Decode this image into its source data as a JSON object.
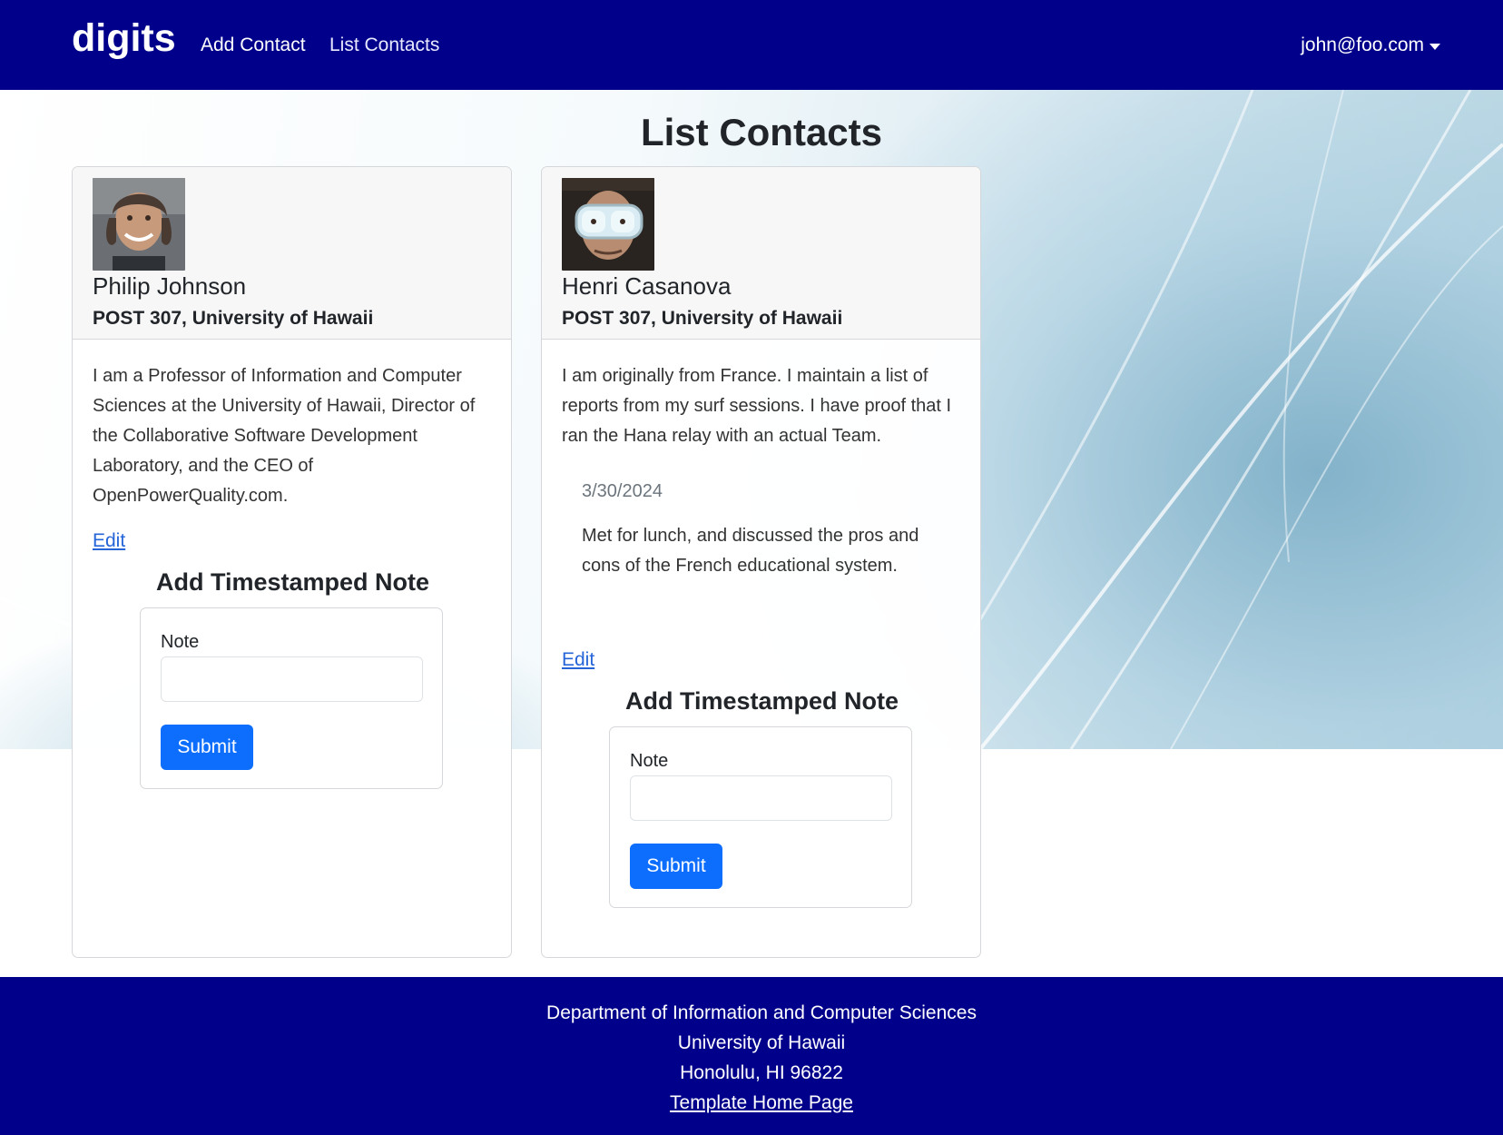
{
  "navbar": {
    "brand": "digits",
    "links": [
      "Add Contact",
      "List Contacts"
    ],
    "user": "john@foo.com"
  },
  "page": {
    "title": "List Contacts"
  },
  "contacts": [
    {
      "name": "Philip Johnson",
      "address": "POST 307, University of Hawaii",
      "description": "I am a Professor of Information and Computer Sciences at the University of Hawaii, Director of the Collaborative Software Development Laboratory, and the CEO of OpenPowerQuality.com.",
      "notes": [],
      "edit_label": "Edit",
      "add_note_title": "Add Timestamped Note",
      "note_label": "Note",
      "note_value": "",
      "submit_label": "Submit"
    },
    {
      "name": "Henri Casanova",
      "address": "POST 307, University of Hawaii",
      "description": "I am originally from France. I maintain a list of reports from my surf sessions. I have proof that I ran the Hana relay with an actual Team.",
      "notes": [
        {
          "date": "3/30/2024",
          "text": "Met for lunch, and discussed the pros and cons of the French educational system."
        }
      ],
      "edit_label": "Edit",
      "add_note_title": "Add Timestamped Note",
      "note_label": "Note",
      "note_value": "",
      "submit_label": "Submit"
    }
  ],
  "footer": {
    "lines": [
      "Department of Information and Computer Sciences",
      "University of Hawaii",
      "Honolulu, HI 96822"
    ],
    "link": "Template Home Page"
  },
  "colors": {
    "navbar": "#00008b",
    "primary": "#0d6efd",
    "link": "#2565d8"
  }
}
